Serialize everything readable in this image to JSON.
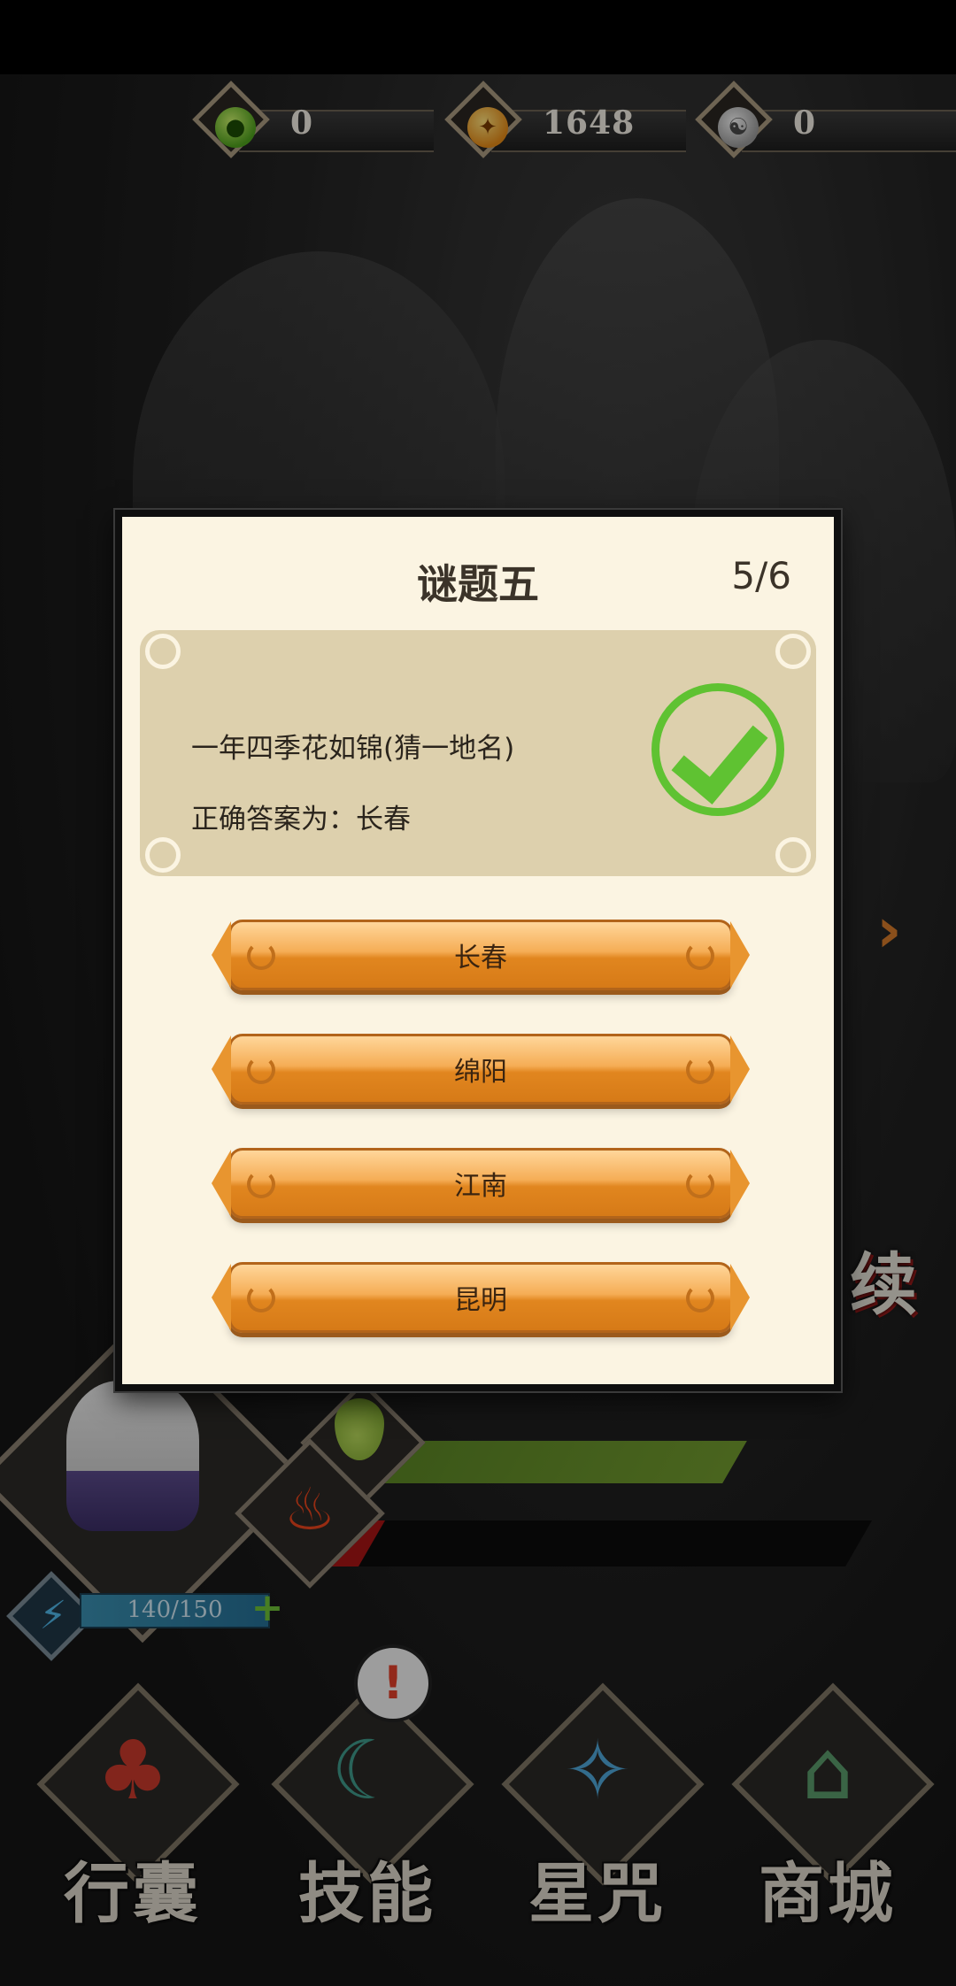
{
  "currencies": [
    {
      "icon": "green-essence-icon",
      "amount": "0",
      "color": "#6fbf2a"
    },
    {
      "icon": "gold-coin-icon",
      "amount": "1648",
      "color": "#f0a030"
    },
    {
      "icon": "silver-yinyang-icon",
      "amount": "0",
      "color": "#b8b8b8"
    }
  ],
  "modal": {
    "title": "谜题五",
    "progress": "5/6",
    "riddle": "一年四季花如锦(猜一地名)",
    "answer_text": "正确答案为：长春",
    "result_icon": "check-icon",
    "options": [
      "长春",
      "绵阳",
      "江南",
      "昆明"
    ]
  },
  "hud": {
    "energy": "140/150",
    "continue_label": "续"
  },
  "bottom_nav": [
    {
      "label": "行囊",
      "icon": "bag-icon"
    },
    {
      "label": "技能",
      "icon": "skill-blade-icon"
    },
    {
      "label": "星咒",
      "icon": "star-scroll-icon"
    },
    {
      "label": "商城",
      "icon": "shop-icon"
    }
  ],
  "colors": {
    "modal_bg": "#fbf4e2",
    "card_bg": "#ddd0ad",
    "button": "#e8952f",
    "check": "#5fc232"
  }
}
